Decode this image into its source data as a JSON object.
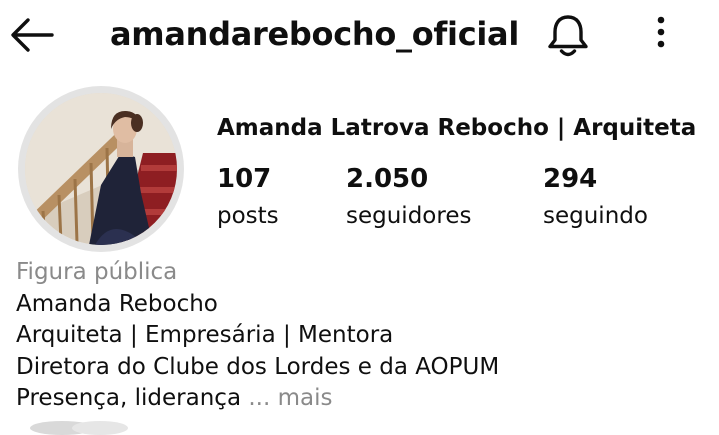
{
  "header": {
    "username": "amandarebocho_oficial",
    "back_icon": "arrow-left-icon",
    "bell_icon": "bell-icon",
    "more_icon": "more-vertical-icon"
  },
  "profile": {
    "display_name": "Amanda Latrova Rebocho | Arquiteta",
    "stats": {
      "posts": {
        "value": "107",
        "label": "posts"
      },
      "followers": {
        "value": "2.050",
        "label": "seguidores"
      },
      "following": {
        "value": "294",
        "label": "seguindo"
      }
    }
  },
  "bio": {
    "category": "Figura pública",
    "lines": [
      "Amanda Rebocho",
      "Arquiteta | Empresária | Mentora",
      "Diretora do Clube dos Lordes e da AOPUM"
    ],
    "last_line_text": "Presença, liderança",
    "more_label": "... mais"
  },
  "colors": {
    "text": "#0f0f0f",
    "muted": "#8a8a8a",
    "avatar_ring": "#e3e3e3"
  }
}
